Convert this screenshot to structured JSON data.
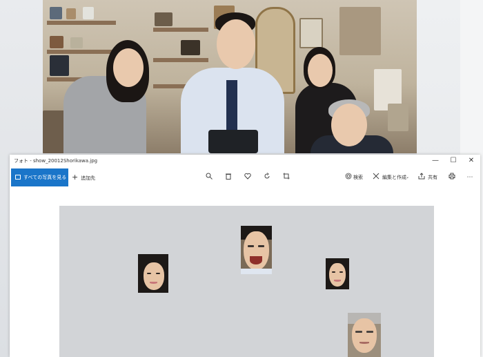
{
  "window": {
    "title": "フォト - show_20012Shorikawa.jpg",
    "controls": {
      "minimize": "—",
      "maximize": "☐",
      "close": "✕"
    }
  },
  "toolbar": {
    "see_all_label": "すべての写真を見る",
    "add_label": "追加先",
    "search_label": "検索",
    "edit_create_label": "編集と作成",
    "share_label": "共有",
    "icons": [
      "zoom-icon",
      "trash-icon",
      "heart-icon",
      "rotate-icon",
      "crop-icon"
    ]
  },
  "canvas": {
    "background": "#d2d4d7",
    "faces": [
      "face-woman-left",
      "face-man-center",
      "face-woman-right",
      "face-man-bottom"
    ]
  },
  "colors": {
    "accent": "#1a75c9"
  }
}
